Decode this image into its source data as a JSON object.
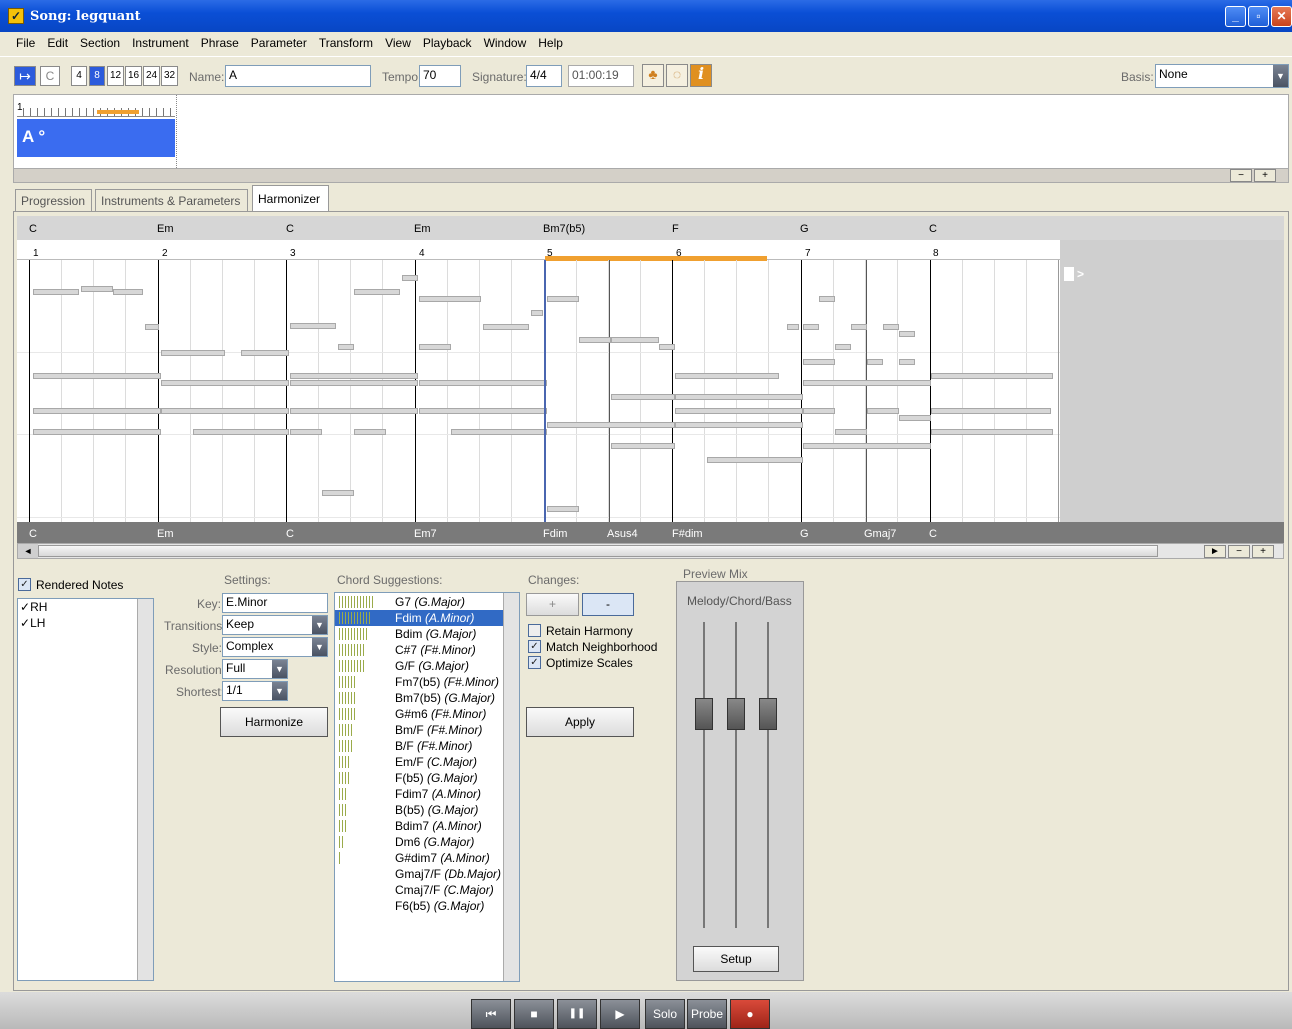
{
  "window": {
    "title": "Song: legquant",
    "minimize": "_",
    "restore": "▫",
    "close": "✕"
  },
  "menu": [
    "File",
    "Edit",
    "Section",
    "Instrument",
    "Phrase",
    "Parameter",
    "Transform",
    "View",
    "Playback",
    "Window",
    "Help"
  ],
  "toolbar": {
    "mode_c": "C",
    "grid": [
      "4",
      "8",
      "12",
      "16",
      "24",
      "32"
    ],
    "grid_selected": "8",
    "name_label": "Name:",
    "name_value": "A",
    "tempo_label": "Tempo:",
    "tempo_value": "70",
    "signature_label": "Signature:",
    "signature_value": "4/4",
    "time_value": "01:00:19",
    "info_icon": "i",
    "basis_label": "Basis:",
    "basis_value": "None"
  },
  "section": {
    "block_label": "A °",
    "ruler_start": "1",
    "minus": "−",
    "plus": "+"
  },
  "tabs": [
    "Progression",
    "Instruments & Parameters",
    "Harmonizer"
  ],
  "tabs_active": "Harmonizer",
  "roll": {
    "top_chords": [
      "C",
      "Em",
      "C",
      "Em",
      "Bm7(b5)",
      "F",
      "G",
      "C"
    ],
    "bar_numbers": [
      "1",
      "2",
      "3",
      "4",
      "5",
      "6",
      "7",
      "8"
    ],
    "bottom_chords": [
      "C",
      "Em",
      "C",
      "Em7",
      "Fdim",
      "Asus4",
      "F#dim",
      "G",
      "Gmaj7",
      "C"
    ],
    "expand_label": ">",
    "scroll_left": "◄",
    "scroll_right": "►",
    "zoom_minus": "−",
    "zoom_plus": "+"
  },
  "rendered": {
    "label": "Rendered Notes",
    "checked": true,
    "tracks": [
      "RH",
      "LH"
    ]
  },
  "settings": {
    "title": "Settings:",
    "key_label": "Key:",
    "key_value": "E.Minor",
    "transitions_label": "Transitions:",
    "transitions_value": "Keep",
    "style_label": "Style:",
    "style_value": "Complex",
    "resolution_label": "Resolution:",
    "resolution_value": "Full",
    "shortest_label": "Shortest:",
    "shortest_value": "1/1",
    "harmonize_button": "Harmonize"
  },
  "suggestions": {
    "title": "Chord Suggestions:",
    "selected_index": 1,
    "items": [
      {
        "chord": "G7",
        "key": "(G.Major)",
        "score": 12
      },
      {
        "chord": "Fdim",
        "key": "(A.Minor)",
        "score": 11
      },
      {
        "chord": "Bdim",
        "key": "(G.Major)",
        "score": 10
      },
      {
        "chord": "C#7",
        "key": "(F#.Minor)",
        "score": 9
      },
      {
        "chord": "G/F",
        "key": "(G.Major)",
        "score": 9
      },
      {
        "chord": "Fm7(b5)",
        "key": "(F#.Minor)",
        "score": 6
      },
      {
        "chord": "Bm7(b5)",
        "key": "(G.Major)",
        "score": 6
      },
      {
        "chord": "G#m6",
        "key": "(F#.Minor)",
        "score": 6
      },
      {
        "chord": "Bm/F",
        "key": "(F#.Minor)",
        "score": 5
      },
      {
        "chord": "B/F",
        "key": "(F#.Minor)",
        "score": 5
      },
      {
        "chord": "Em/F",
        "key": "(C.Major)",
        "score": 4
      },
      {
        "chord": "F(b5)",
        "key": "(G.Major)",
        "score": 4
      },
      {
        "chord": "Fdim7",
        "key": "(A.Minor)",
        "score": 3
      },
      {
        "chord": "B(b5)",
        "key": "(G.Major)",
        "score": 3
      },
      {
        "chord": "Bdim7",
        "key": "(A.Minor)",
        "score": 3
      },
      {
        "chord": "Dm6",
        "key": "(G.Major)",
        "score": 2
      },
      {
        "chord": "G#dim7",
        "key": "(A.Minor)",
        "score": 1
      },
      {
        "chord": "Gmaj7/F",
        "key": "(Db.Major)",
        "score": 0
      },
      {
        "chord": "Cmaj7/F",
        "key": "(C.Major)",
        "score": 0
      },
      {
        "chord": "F6(b5)",
        "key": "(G.Major)",
        "score": 0
      }
    ]
  },
  "changes": {
    "title": "Changes:",
    "plus": "+",
    "minus": "-",
    "retain_harmony": "Retain Harmony",
    "retain_checked": false,
    "match_neighborhood": "Match Neighborhood",
    "match_checked": true,
    "optimize_scales": "Optimize Scales",
    "optimize_checked": true,
    "apply_button": "Apply"
  },
  "mix": {
    "title": "Preview Mix",
    "subtitle": "Melody/Chord/Bass",
    "setup_button": "Setup"
  },
  "transport": {
    "prev": "⏮",
    "stop": "■",
    "pause": "❚❚",
    "play": "▶",
    "solo": "Solo",
    "probe": "Probe",
    "record": "●"
  }
}
